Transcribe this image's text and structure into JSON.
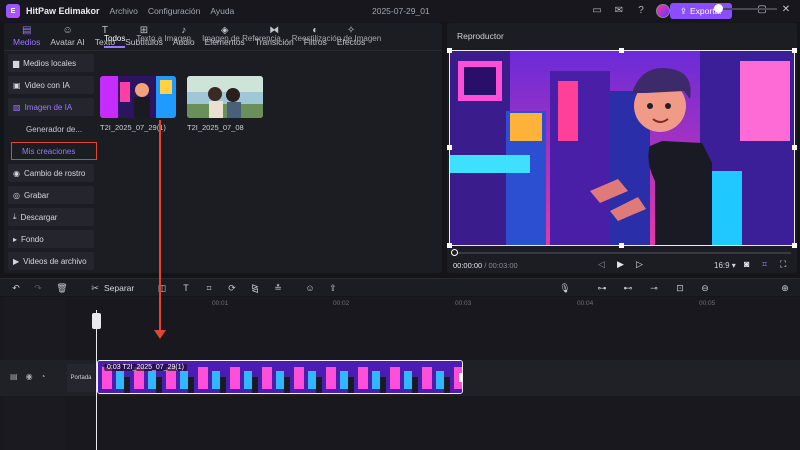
{
  "app": {
    "name": "HitPaw Edimakor",
    "logo_letter": "E",
    "menu": [
      "Archivo",
      "Configuración",
      "Ayuda"
    ],
    "project_name": "2025-07-29_01",
    "export_label": "Exportar"
  },
  "media_tabs": [
    {
      "label": "Medios",
      "icon": "folder-icon"
    },
    {
      "label": "Avatar AI",
      "icon": "avatar-icon"
    },
    {
      "label": "Texto",
      "icon": "text-icon"
    },
    {
      "label": "Subtítulos",
      "icon": "subtitles-icon"
    },
    {
      "label": "Audio",
      "icon": "music-icon"
    },
    {
      "label": "Elementos",
      "icon": "elements-icon"
    },
    {
      "label": "Transición",
      "icon": "transition-icon"
    },
    {
      "label": "Filtros",
      "icon": "filter-icon"
    },
    {
      "label": "Efectos",
      "icon": "effects-icon"
    }
  ],
  "sidebar": {
    "items": [
      {
        "label": "Medios locales",
        "icon": "folder-icon"
      },
      {
        "label": "Video con IA",
        "icon": "ai-video-icon"
      },
      {
        "label": "Imagen de IA",
        "icon": "ai-image-icon"
      }
    ],
    "sub_items": [
      "Generador de...",
      "Mis creaciones"
    ],
    "more_items": [
      {
        "label": "Cambio de rostro",
        "icon": "face-swap-icon"
      },
      {
        "label": "Grabar",
        "icon": "record-icon"
      },
      {
        "label": "Descargar",
        "icon": "download-icon"
      },
      {
        "label": "Fondo",
        "icon": "background-icon"
      },
      {
        "label": "Videos de archivo",
        "icon": "stock-video-icon"
      }
    ]
  },
  "subtabs": [
    "Todos",
    "Texto a Imagen",
    "Imagen de Referencia",
    "Reestilización de Imagen"
  ],
  "media_items": [
    {
      "label": "T2I_2025_07_29(1)"
    },
    {
      "label": "T2I_2025_07_08"
    }
  ],
  "player": {
    "title": "Reproductor",
    "current_time": "00:00:00",
    "total_time": "00:03:00",
    "ratio": "16:9",
    "progress": 0
  },
  "timeline": {
    "split_label": "Separar",
    "ruler_labels": [
      "00:01",
      "00:02",
      "00:03",
      "00:04",
      "00:05"
    ],
    "cover_label": "Portada",
    "clip_label": "0:03 T2I_2025_07_29(1)",
    "zoom_level": 0
  },
  "colors": {
    "accent": "#9b78ff",
    "export": "#8a4dff",
    "highlight": "#e2462f",
    "clip": "#6b2fd9"
  }
}
